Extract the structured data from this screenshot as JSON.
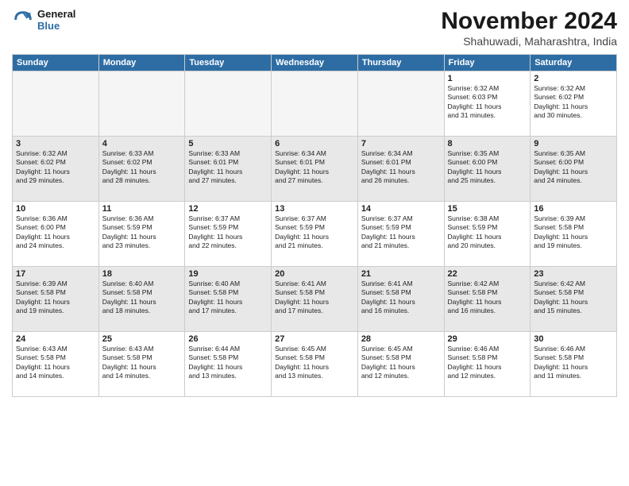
{
  "header": {
    "logo_line1": "General",
    "logo_line2": "Blue",
    "main_title": "November 2024",
    "subtitle": "Shahuwadi, Maharashtra, India"
  },
  "days_of_week": [
    "Sunday",
    "Monday",
    "Tuesday",
    "Wednesday",
    "Thursday",
    "Friday",
    "Saturday"
  ],
  "weeks": [
    {
      "shaded": false,
      "days": [
        {
          "num": "",
          "info": ""
        },
        {
          "num": "",
          "info": ""
        },
        {
          "num": "",
          "info": ""
        },
        {
          "num": "",
          "info": ""
        },
        {
          "num": "",
          "info": ""
        },
        {
          "num": "1",
          "info": "Sunrise: 6:32 AM\nSunset: 6:03 PM\nDaylight: 11 hours\nand 31 minutes."
        },
        {
          "num": "2",
          "info": "Sunrise: 6:32 AM\nSunset: 6:02 PM\nDaylight: 11 hours\nand 30 minutes."
        }
      ]
    },
    {
      "shaded": true,
      "days": [
        {
          "num": "3",
          "info": "Sunrise: 6:32 AM\nSunset: 6:02 PM\nDaylight: 11 hours\nand 29 minutes."
        },
        {
          "num": "4",
          "info": "Sunrise: 6:33 AM\nSunset: 6:02 PM\nDaylight: 11 hours\nand 28 minutes."
        },
        {
          "num": "5",
          "info": "Sunrise: 6:33 AM\nSunset: 6:01 PM\nDaylight: 11 hours\nand 27 minutes."
        },
        {
          "num": "6",
          "info": "Sunrise: 6:34 AM\nSunset: 6:01 PM\nDaylight: 11 hours\nand 27 minutes."
        },
        {
          "num": "7",
          "info": "Sunrise: 6:34 AM\nSunset: 6:01 PM\nDaylight: 11 hours\nand 26 minutes."
        },
        {
          "num": "8",
          "info": "Sunrise: 6:35 AM\nSunset: 6:00 PM\nDaylight: 11 hours\nand 25 minutes."
        },
        {
          "num": "9",
          "info": "Sunrise: 6:35 AM\nSunset: 6:00 PM\nDaylight: 11 hours\nand 24 minutes."
        }
      ]
    },
    {
      "shaded": false,
      "days": [
        {
          "num": "10",
          "info": "Sunrise: 6:36 AM\nSunset: 6:00 PM\nDaylight: 11 hours\nand 24 minutes."
        },
        {
          "num": "11",
          "info": "Sunrise: 6:36 AM\nSunset: 5:59 PM\nDaylight: 11 hours\nand 23 minutes."
        },
        {
          "num": "12",
          "info": "Sunrise: 6:37 AM\nSunset: 5:59 PM\nDaylight: 11 hours\nand 22 minutes."
        },
        {
          "num": "13",
          "info": "Sunrise: 6:37 AM\nSunset: 5:59 PM\nDaylight: 11 hours\nand 21 minutes."
        },
        {
          "num": "14",
          "info": "Sunrise: 6:37 AM\nSunset: 5:59 PM\nDaylight: 11 hours\nand 21 minutes."
        },
        {
          "num": "15",
          "info": "Sunrise: 6:38 AM\nSunset: 5:59 PM\nDaylight: 11 hours\nand 20 minutes."
        },
        {
          "num": "16",
          "info": "Sunrise: 6:39 AM\nSunset: 5:58 PM\nDaylight: 11 hours\nand 19 minutes."
        }
      ]
    },
    {
      "shaded": true,
      "days": [
        {
          "num": "17",
          "info": "Sunrise: 6:39 AM\nSunset: 5:58 PM\nDaylight: 11 hours\nand 19 minutes."
        },
        {
          "num": "18",
          "info": "Sunrise: 6:40 AM\nSunset: 5:58 PM\nDaylight: 11 hours\nand 18 minutes."
        },
        {
          "num": "19",
          "info": "Sunrise: 6:40 AM\nSunset: 5:58 PM\nDaylight: 11 hours\nand 17 minutes."
        },
        {
          "num": "20",
          "info": "Sunrise: 6:41 AM\nSunset: 5:58 PM\nDaylight: 11 hours\nand 17 minutes."
        },
        {
          "num": "21",
          "info": "Sunrise: 6:41 AM\nSunset: 5:58 PM\nDaylight: 11 hours\nand 16 minutes."
        },
        {
          "num": "22",
          "info": "Sunrise: 6:42 AM\nSunset: 5:58 PM\nDaylight: 11 hours\nand 16 minutes."
        },
        {
          "num": "23",
          "info": "Sunrise: 6:42 AM\nSunset: 5:58 PM\nDaylight: 11 hours\nand 15 minutes."
        }
      ]
    },
    {
      "shaded": false,
      "days": [
        {
          "num": "24",
          "info": "Sunrise: 6:43 AM\nSunset: 5:58 PM\nDaylight: 11 hours\nand 14 minutes."
        },
        {
          "num": "25",
          "info": "Sunrise: 6:43 AM\nSunset: 5:58 PM\nDaylight: 11 hours\nand 14 minutes."
        },
        {
          "num": "26",
          "info": "Sunrise: 6:44 AM\nSunset: 5:58 PM\nDaylight: 11 hours\nand 13 minutes."
        },
        {
          "num": "27",
          "info": "Sunrise: 6:45 AM\nSunset: 5:58 PM\nDaylight: 11 hours\nand 13 minutes."
        },
        {
          "num": "28",
          "info": "Sunrise: 6:45 AM\nSunset: 5:58 PM\nDaylight: 11 hours\nand 12 minutes."
        },
        {
          "num": "29",
          "info": "Sunrise: 6:46 AM\nSunset: 5:58 PM\nDaylight: 11 hours\nand 12 minutes."
        },
        {
          "num": "30",
          "info": "Sunrise: 6:46 AM\nSunset: 5:58 PM\nDaylight: 11 hours\nand 11 minutes."
        }
      ]
    }
  ]
}
